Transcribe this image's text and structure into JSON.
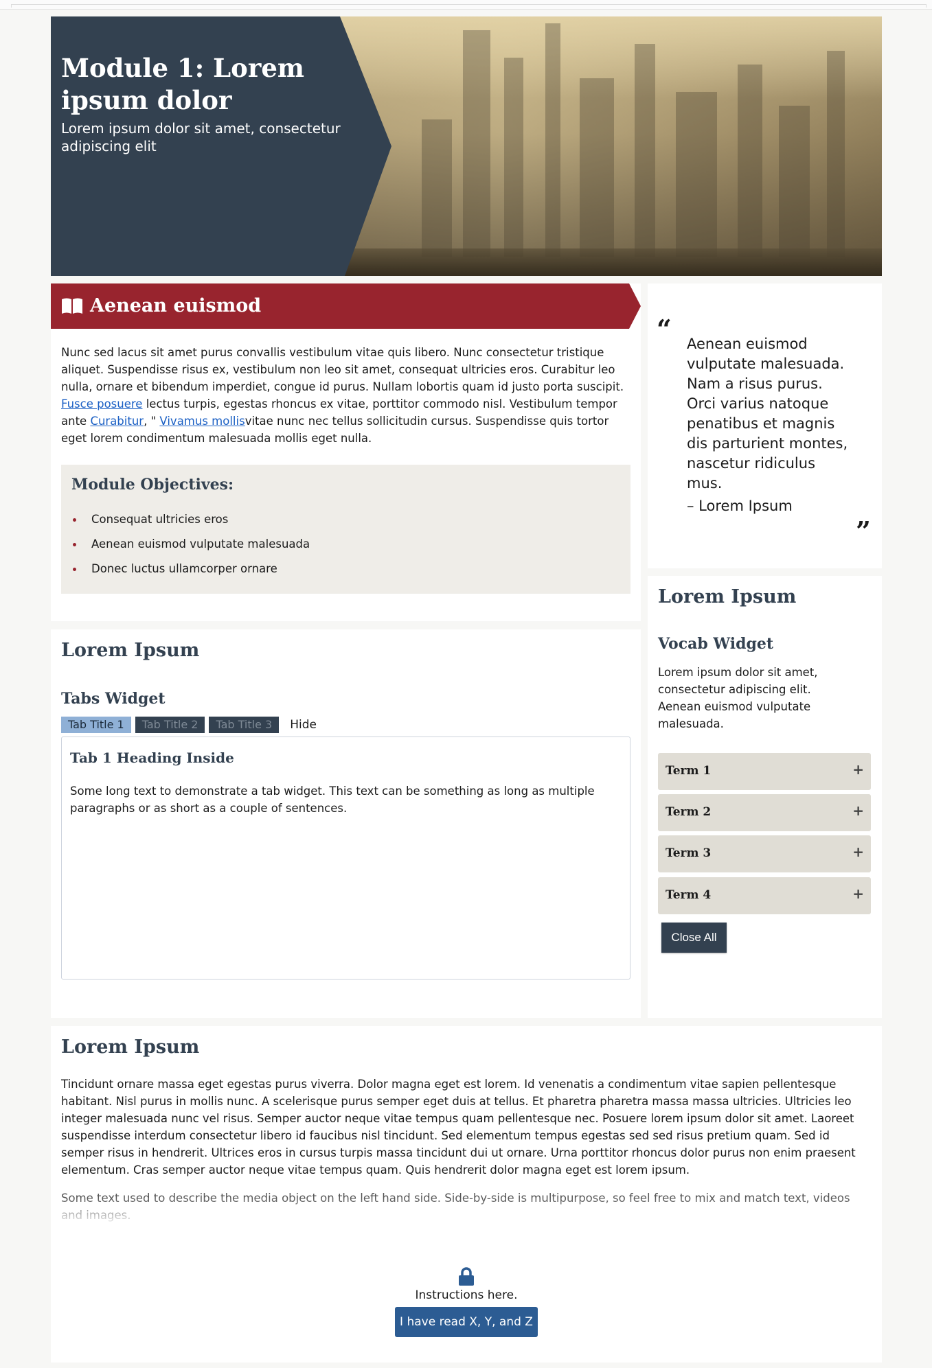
{
  "hero": {
    "title": "Module 1: Lorem ipsum dolor",
    "subtitle": "Lorem ipsum dolor sit amet, consectetur adipiscing elit"
  },
  "intro": {
    "banner_icon": "open-book-icon",
    "banner_title": "Aenean euismod",
    "paragraph_part1": "Nunc sed lacus sit amet purus convallis vestibulum vitae quis libero. Nunc consectetur tristique aliquet. Suspendisse risus ex, vestibulum non leo sit amet, consequat ultricies eros. Curabitur leo nulla, ornare et bibendum imperdiet, congue id purus. Nullam lobortis quam id justo porta suscipit. ",
    "link1": "Fusce posuere",
    "paragraph_part2": " lectus turpis, egestas rhoncus ex vitae, porttitor commodo nisl. Vestibulum tempor ante ",
    "link2": "Curabitur",
    "paragraph_part3": ", \" ",
    "link3": "Vivamus mollis",
    "paragraph_part4": "vitae nunc nec tellus sollicitudin cursus. Suspendisse quis tortor eget lorem condimentum malesuada mollis eget nulla.",
    "objectives_title": "Module Objectives:",
    "objectives": [
      "Consequat ultricies eros",
      "Aenean euismod vulputate malesuada",
      "Donec luctus ullamcorper ornare"
    ]
  },
  "quote": {
    "text": "Aenean euismod vulputate malesuada. Nam a risus purus. Orci varius natoque penatibus et magnis dis parturient montes, nascetur ridiculus mus.",
    "author": "– Lorem Ipsum"
  },
  "tabs_section": {
    "heading": "Lorem Ipsum",
    "widget_title": "Tabs Widget",
    "tabs": [
      "Tab Title 1",
      "Tab Title 2",
      "Tab Title 3"
    ],
    "hide_label": "Hide",
    "panel_heading": "Tab 1 Heading Inside",
    "panel_text": "Some long text to demonstrate a tab widget. This text can be something as long as multiple paragraphs or as short as a couple of sentences."
  },
  "vocab_section": {
    "heading": "Lorem Ipsum",
    "widget_title": "Vocab Widget",
    "description": "Lorem ipsum dolor sit amet, consectetur adipiscing elit. Aenean euismod vulputate malesuada.",
    "terms": [
      "Term 1",
      "Term 2",
      "Term 3",
      "Term 4"
    ],
    "close_all_label": "Close All"
  },
  "bottom_section": {
    "heading": "Lorem Ipsum",
    "paragraph": "Tincidunt ornare massa eget egestas purus viverra. Dolor magna eget est lorem. Id venenatis a condimentum vitae sapien pellentesque habitant. Nisl purus in mollis nunc. A scelerisque purus semper eget duis at tellus. Et pharetra pharetra massa massa ultricies. Ultricies leo integer malesuada nunc vel risus. Semper auctor neque vitae tempus quam pellentesque nec. Posuere lorem ipsum dolor sit amet. Laoreet suspendisse interdum consectetur libero id faucibus nisl tincidunt. Sed elementum tempus egestas sed sed risus pretium quam. Sed id semper risus in hendrerit. Ultrices eros in cursus turpis massa tincidunt dui ut ornare. Urna porttitor rhoncus dolor purus non enim praesent elementum. Cras semper auctor neque vitae tempus quam. Quis hendrerit dolor magna eget est lorem ipsum.",
    "media_text": "Some text used to describe the media object on the left hand side. Side-by-side is multipurpose, so feel free to mix and match text, videos and images.",
    "lock_icon": "lock-icon",
    "instructions": "Instructions here.",
    "confirm_button": "I have read X, Y, and Z"
  },
  "colors": {
    "navy": "#334150",
    "crimson": "#98242e",
    "button_blue": "#2c5c93",
    "tab_active": "#8fb0d6",
    "panel_beige": "#efede8",
    "term_bg": "#e0ddd5"
  }
}
